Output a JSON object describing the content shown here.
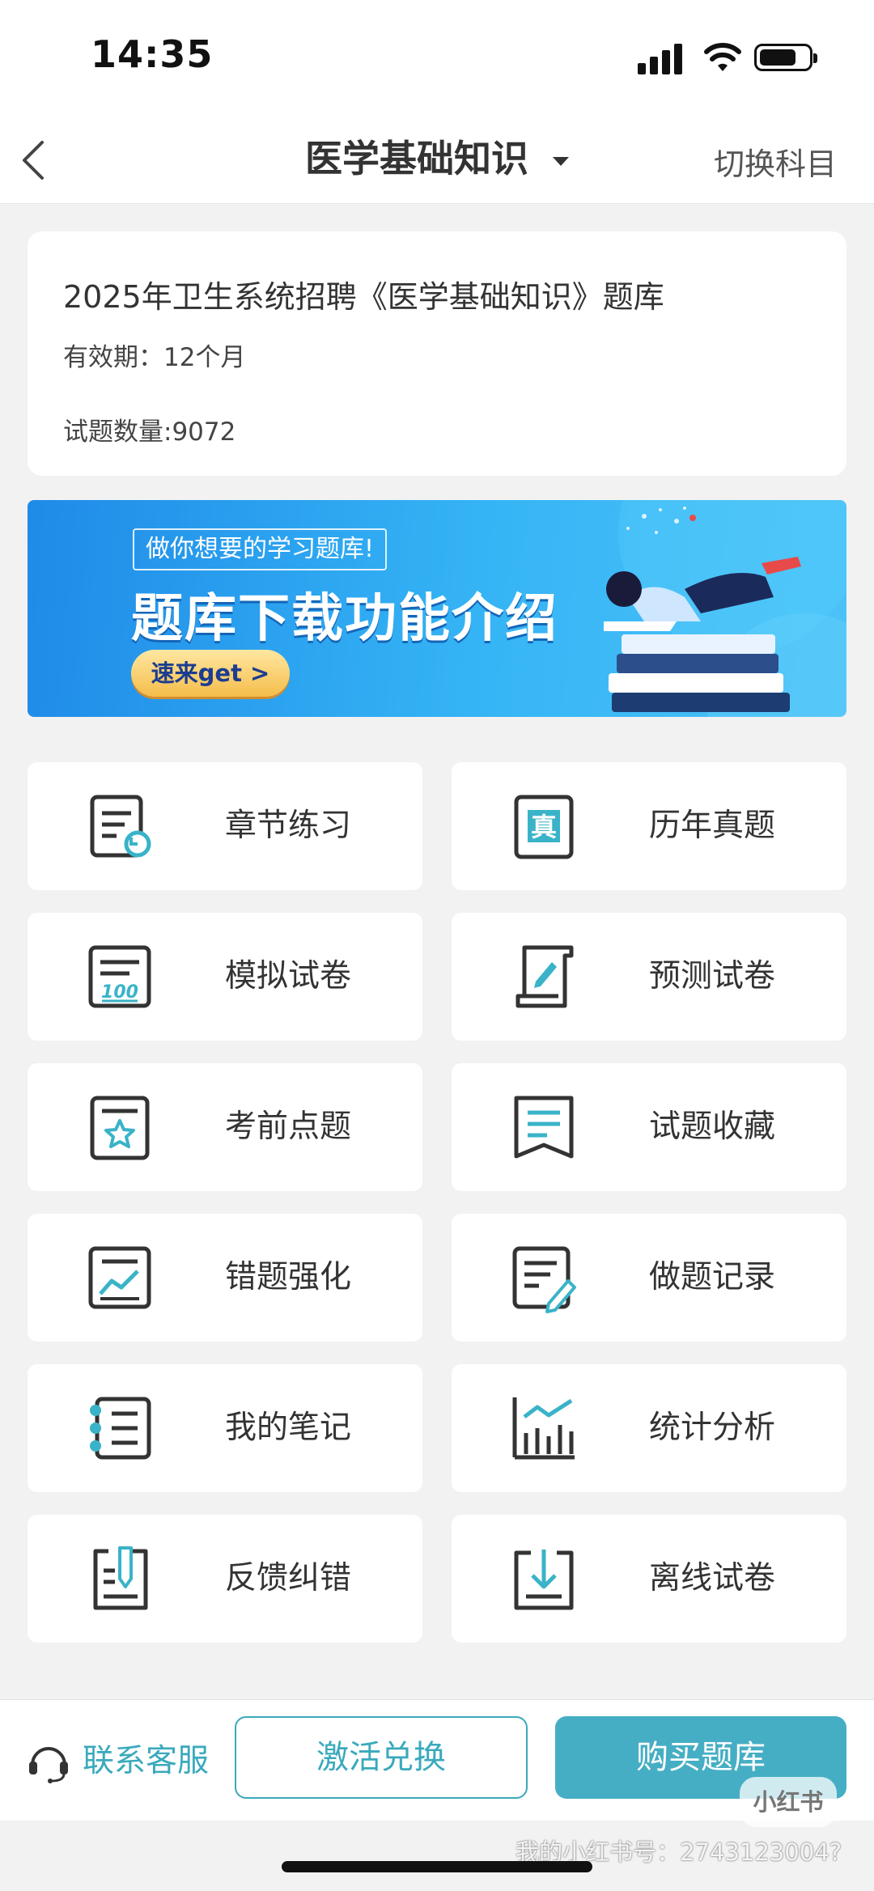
{
  "status_bar": {
    "time": "14:35"
  },
  "nav": {
    "title": "医学基础知识",
    "switch_label": "切换科目"
  },
  "bank": {
    "title": "2025年卫生系统招聘《医学基础知识》题库",
    "validity": "有效期：12个月",
    "question_count": "试题数量:9072"
  },
  "banner": {
    "tag": "做你想要的学习题库!",
    "headline": "题库下载功能介绍",
    "cta": "速来get >"
  },
  "features": [
    {
      "label": "章节练习",
      "icon": "chapter-practice-icon"
    },
    {
      "label": "历年真题",
      "icon": "past-exams-icon"
    },
    {
      "label": "模拟试卷",
      "icon": "mock-paper-icon"
    },
    {
      "label": "预测试卷",
      "icon": "prediction-paper-icon"
    },
    {
      "label": "考前点题",
      "icon": "pre-exam-picks-icon"
    },
    {
      "label": "试题收藏",
      "icon": "bookmark-icon"
    },
    {
      "label": "错题强化",
      "icon": "mistake-chart-icon"
    },
    {
      "label": "做题记录",
      "icon": "record-edit-icon"
    },
    {
      "label": "我的笔记",
      "icon": "notebook-icon"
    },
    {
      "label": "统计分析",
      "icon": "statistics-icon"
    },
    {
      "label": "反馈纠错",
      "icon": "feedback-icon"
    },
    {
      "label": "离线试卷",
      "icon": "download-icon"
    }
  ],
  "bottom": {
    "service_label": "联系客服",
    "activate_label": "激活兑换",
    "buy_label": "购买题库"
  },
  "watermark": {
    "badge": "小红书",
    "text": "我的小红书号：2743123004?"
  },
  "colors": {
    "accent": "#45aec4",
    "icon_accent": "#3ab3c8",
    "icon_dark": "#333333"
  }
}
